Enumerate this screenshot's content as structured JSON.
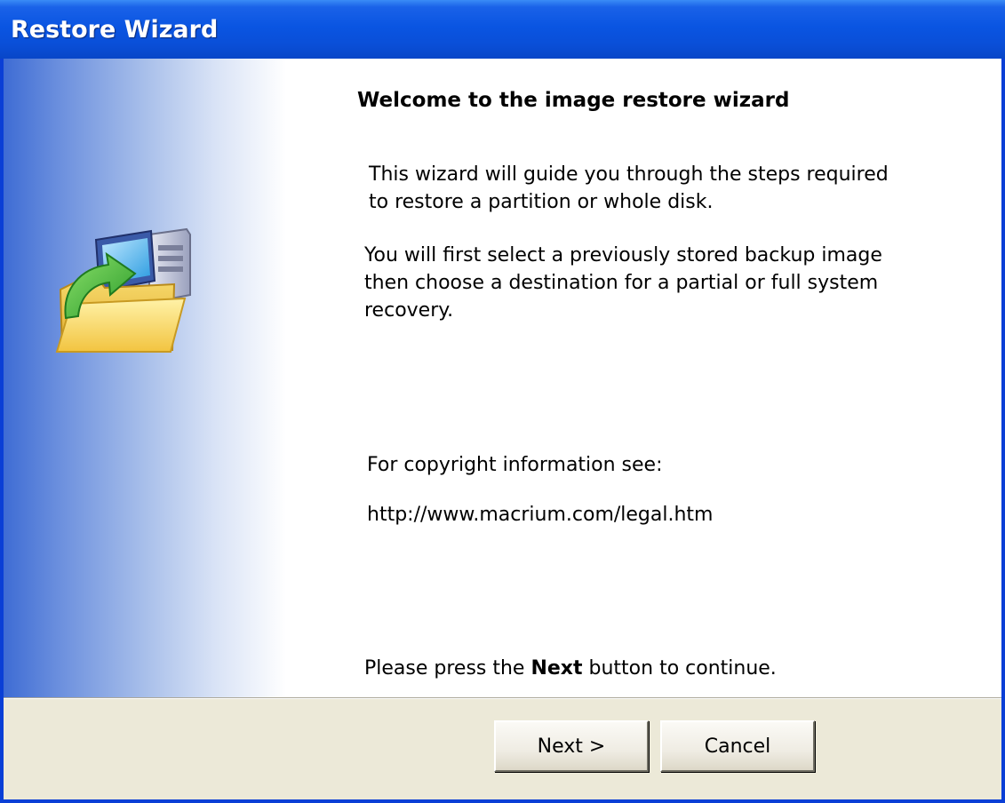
{
  "window": {
    "title": "Restore Wizard"
  },
  "main": {
    "heading": "Welcome to the image restore wizard",
    "intro": "This wizard will guide you through the steps required\nto restore a partition or whole disk.",
    "details": "You will first select a previously stored backup image\nthen choose a destination for a partial or full system\nrecovery.",
    "copyright_label": "For copyright information see:",
    "copyright_url": "http://www.macrium.com/legal.htm",
    "instruction_prefix": "Please press the ",
    "instruction_bold": "Next",
    "instruction_suffix": " button to continue."
  },
  "buttons": {
    "next": "Next >",
    "cancel": "Cancel"
  },
  "icons": {
    "wizard": "restore-folder-computer-icon"
  },
  "colors": {
    "titlebar": "#0a55e2",
    "side_panel_start": "#3e6cd4",
    "dialog_face": "#ece9d8"
  }
}
